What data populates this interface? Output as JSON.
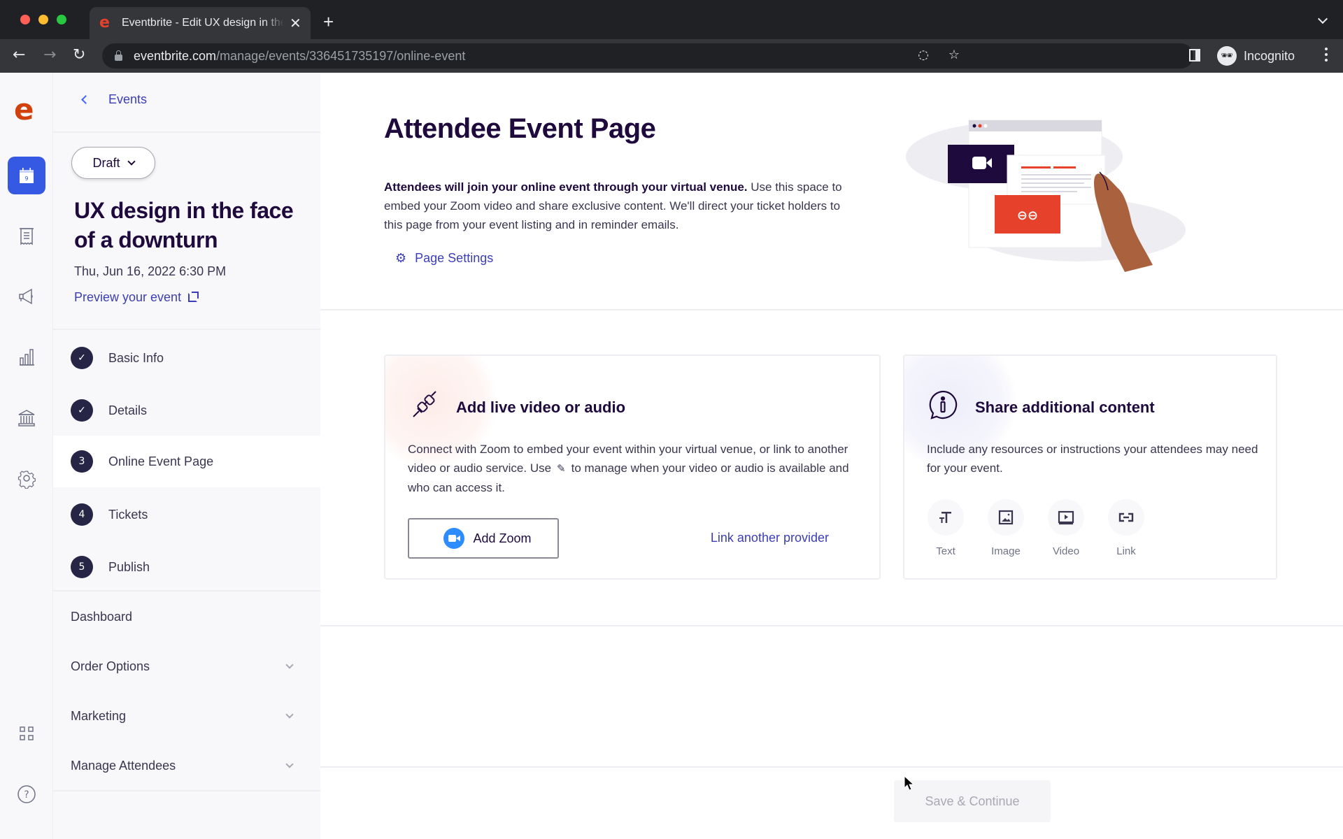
{
  "browser": {
    "tab_title": "Eventbrite - Edit UX design in the face of a downturn",
    "tab_favicon": "e",
    "url_domain": "eventbrite.com",
    "url_path": "/manage/events/336451735197/online-event",
    "profile_label": "Incognito"
  },
  "rail": {
    "logo": "e",
    "items": [
      {
        "icon": "calendar-icon",
        "active": true,
        "badge": "9"
      },
      {
        "icon": "receipt-icon",
        "active": false
      },
      {
        "icon": "megaphone-icon",
        "active": false
      },
      {
        "icon": "bar-chart-icon",
        "active": false
      },
      {
        "icon": "bank-icon",
        "active": false
      },
      {
        "icon": "gear-icon",
        "active": false
      },
      {
        "icon": "apps-grid-icon",
        "active": false
      },
      {
        "icon": "help-icon",
        "active": false
      }
    ]
  },
  "panel": {
    "back_label": "Events",
    "status_button": "Draft",
    "event_title": "UX design in the face of a downturn",
    "event_date": "Thu, Jun 16, 2022 6:30 PM",
    "preview_label": "Preview your event",
    "steps": [
      {
        "badge": "✓",
        "label": "Basic Info",
        "state": "complete"
      },
      {
        "badge": "✓",
        "label": "Details",
        "state": "complete"
      },
      {
        "badge": "3",
        "label": "Online Event Page",
        "state": "active"
      },
      {
        "badge": "4",
        "label": "Tickets",
        "state": "pending"
      },
      {
        "badge": "5",
        "label": "Publish",
        "state": "pending"
      }
    ],
    "dashboard_label": "Dashboard",
    "sections": [
      {
        "label": "Order Options"
      },
      {
        "label": "Marketing"
      },
      {
        "label": "Manage Attendees"
      }
    ]
  },
  "main": {
    "title": "Attendee Event Page",
    "intro_bold": "Attendees will join your online event through your virtual venue.",
    "intro_rest": " Use this space to embed your Zoom video and share exclusive content. We'll direct your ticket holders to this page from your event listing and in reminder emails.",
    "page_settings_label": "Page Settings",
    "video_card": {
      "title": "Add live video or audio",
      "text_before_icon": "Connect with Zoom to embed your event within your virtual venue, or link to another video or audio service. Use",
      "text_after_icon": "to manage when your video or audio is available and who can access it.",
      "add_zoom_label": "Add Zoom",
      "link_provider_label": "Link another provider"
    },
    "content_card": {
      "title": "Share additional content",
      "text": "Include any resources or instructions your attendees may need for your event.",
      "options": [
        {
          "label": "Text",
          "icon": "text-icon"
        },
        {
          "label": "Image",
          "icon": "image-icon"
        },
        {
          "label": "Video",
          "icon": "video-icon"
        },
        {
          "label": "Link",
          "icon": "link-icon"
        }
      ]
    },
    "save_label": "Save & Continue"
  },
  "colors": {
    "brand": "#d1410c",
    "accent": "#3659e3",
    "link": "#3b3eb8",
    "ink": "#1e0a3c"
  }
}
